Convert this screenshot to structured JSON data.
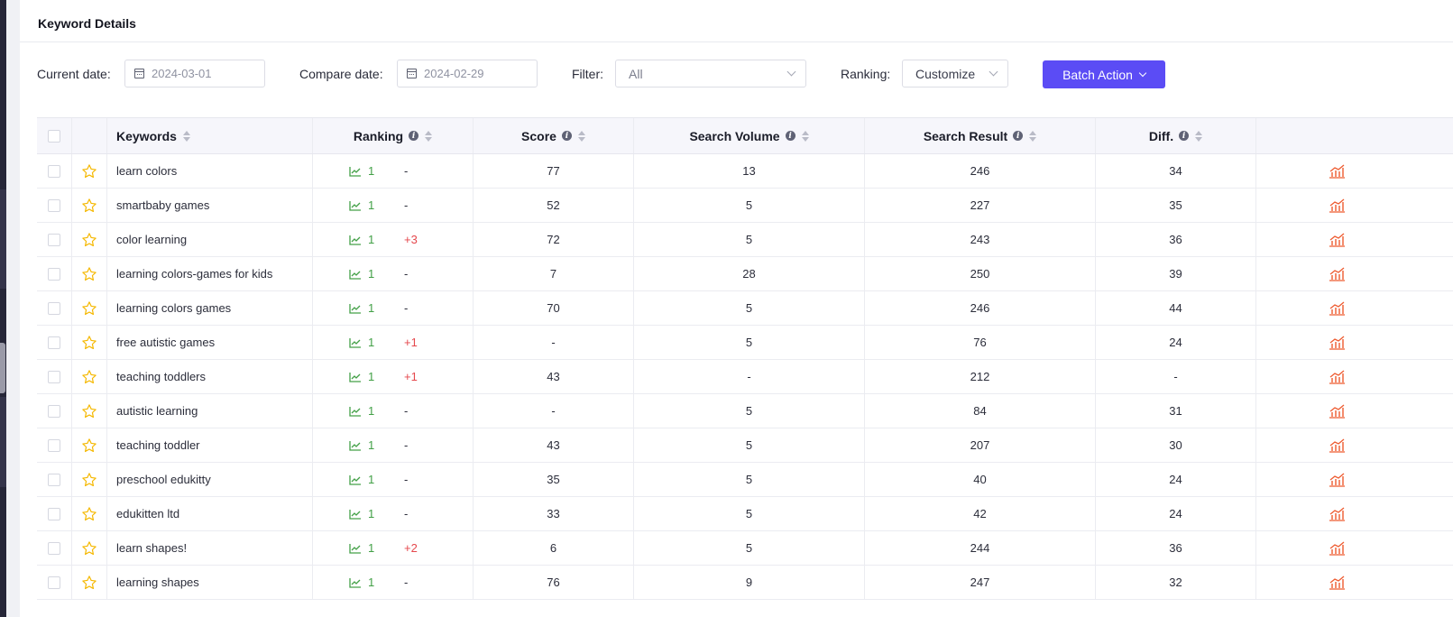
{
  "panel": {
    "title": "Keyword Details"
  },
  "controls": {
    "current_date_label": "Current date:",
    "current_date_value": "2024-03-01",
    "compare_date_label": "Compare date:",
    "compare_date_value": "2024-02-29",
    "filter_label": "Filter:",
    "filter_value": "All",
    "ranking_label": "Ranking:",
    "ranking_value": "Customize",
    "batch_action_label": "Batch Action"
  },
  "table": {
    "headers": {
      "keywords": "Keywords",
      "ranking": "Ranking",
      "score": "Score",
      "search_volume": "Search Volume",
      "search_result": "Search Result",
      "diff": "Diff."
    },
    "rows": [
      {
        "keyword": "learn colors",
        "rank": "1",
        "change": "-",
        "score": "77",
        "volume": "13",
        "result": "246",
        "diff": "34"
      },
      {
        "keyword": "smartbaby games",
        "rank": "1",
        "change": "-",
        "score": "52",
        "volume": "5",
        "result": "227",
        "diff": "35"
      },
      {
        "keyword": "color learning",
        "rank": "1",
        "change": "+3",
        "score": "72",
        "volume": "5",
        "result": "243",
        "diff": "36"
      },
      {
        "keyword": "learning colors-games for kids",
        "rank": "1",
        "change": "-",
        "score": "7",
        "volume": "28",
        "result": "250",
        "diff": "39"
      },
      {
        "keyword": "learning colors games",
        "rank": "1",
        "change": "-",
        "score": "70",
        "volume": "5",
        "result": "246",
        "diff": "44"
      },
      {
        "keyword": "free autistic games",
        "rank": "1",
        "change": "+1",
        "score": "-",
        "volume": "5",
        "result": "76",
        "diff": "24"
      },
      {
        "keyword": "teaching toddlers",
        "rank": "1",
        "change": "+1",
        "score": "43",
        "volume": "-",
        "result": "212",
        "diff": "-"
      },
      {
        "keyword": "autistic learning",
        "rank": "1",
        "change": "-",
        "score": "-",
        "volume": "5",
        "result": "84",
        "diff": "31"
      },
      {
        "keyword": "teaching toddler",
        "rank": "1",
        "change": "-",
        "score": "43",
        "volume": "5",
        "result": "207",
        "diff": "30"
      },
      {
        "keyword": "preschool edukitty",
        "rank": "1",
        "change": "-",
        "score": "35",
        "volume": "5",
        "result": "40",
        "diff": "24"
      },
      {
        "keyword": "edukitten ltd",
        "rank": "1",
        "change": "-",
        "score": "33",
        "volume": "5",
        "result": "42",
        "diff": "24"
      },
      {
        "keyword": "learn shapes!",
        "rank": "1",
        "change": "+2",
        "score": "6",
        "volume": "5",
        "result": "244",
        "diff": "36"
      },
      {
        "keyword": "learning shapes",
        "rank": "1",
        "change": "-",
        "score": "76",
        "volume": "9",
        "result": "247",
        "diff": "32"
      }
    ]
  },
  "icons": {
    "star": "star-outline-icon",
    "rank_trend": "trend-line-icon",
    "row_chart": "bar-line-chart-icon",
    "date": "calendar-icon",
    "info": "info-icon",
    "sort": "sort-icon"
  },
  "colors": {
    "accent": "#5b4cf5",
    "rank_green": "#43a047",
    "change_red": "#e5484d",
    "star_yellow": "#f5b800",
    "chart_orange": "#ee5a2f"
  }
}
